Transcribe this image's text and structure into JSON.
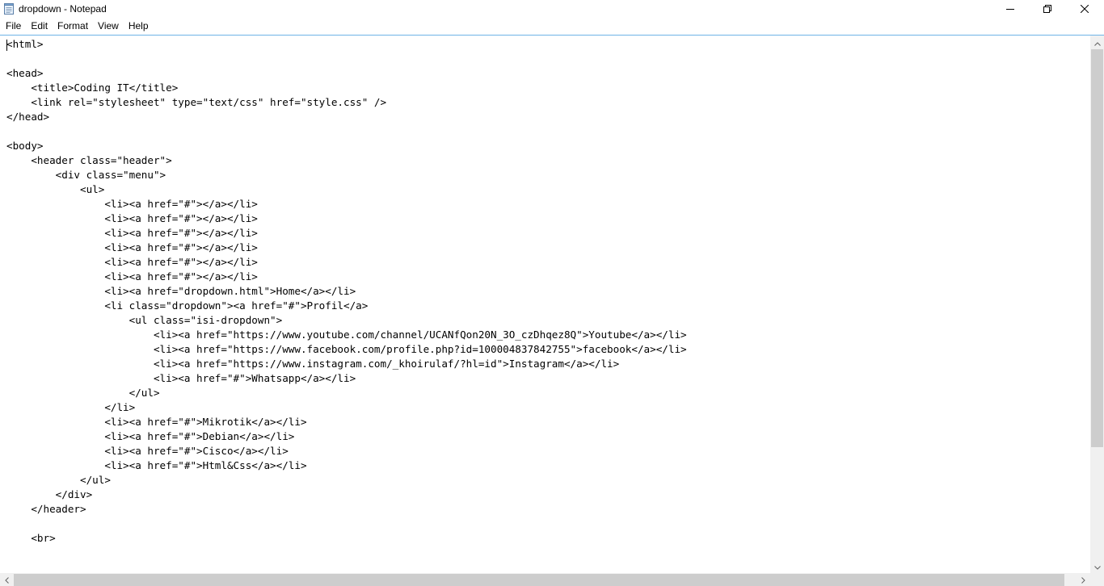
{
  "window": {
    "title": "dropdown - Notepad",
    "icons": {
      "app": "notepad-icon",
      "minimize": "minimize-icon",
      "maximize": "restore-icon",
      "close": "close-icon"
    }
  },
  "menubar": {
    "items": [
      {
        "label": "File"
      },
      {
        "label": "Edit"
      },
      {
        "label": "Format"
      },
      {
        "label": "View"
      },
      {
        "label": "Help"
      }
    ]
  },
  "editor": {
    "lines": [
      "<html>",
      "",
      "<head>",
      "    <title>Coding IT</title>",
      "    <link rel=\"stylesheet\" type=\"text/css\" href=\"style.css\" />",
      "</head>",
      "",
      "<body>",
      "    <header class=\"header\">",
      "        <div class=\"menu\">",
      "            <ul>",
      "                <li><a href=\"#\"></a></li>",
      "                <li><a href=\"#\"></a></li>",
      "                <li><a href=\"#\"></a></li>",
      "                <li><a href=\"#\"></a></li>",
      "                <li><a href=\"#\"></a></li>",
      "                <li><a href=\"#\"></a></li>",
      "                <li><a href=\"dropdown.html\">Home</a></li>",
      "                <li class=\"dropdown\"><a href=\"#\">Profil</a>",
      "                    <ul class=\"isi-dropdown\">",
      "                        <li><a href=\"https://www.youtube.com/channel/UCANfQon20N_3O_czDhqez8Q\">Youtube</a></li>",
      "                        <li><a href=\"https://www.facebook.com/profile.php?id=100004837842755\">facebook</a></li>",
      "                        <li><a href=\"https://www.instagram.com/_khoirulaf/?hl=id\">Instagram</a></li>",
      "                        <li><a href=\"#\">Whatsapp</a></li>",
      "                    </ul>",
      "                </li>",
      "                <li><a href=\"#\">Mikrotik</a></li>",
      "                <li><a href=\"#\">Debian</a></li>",
      "                <li><a href=\"#\">Cisco</a></li>",
      "                <li><a href=\"#\">Html&Css</a></li>",
      "            </ul>",
      "        </div>",
      "    </header>",
      "",
      "    <br>"
    ]
  },
  "colors": {
    "editor_border": "#6fb3e7",
    "scrollbar_track": "#f0f0f0",
    "scrollbar_thumb": "#cdcdcd"
  }
}
